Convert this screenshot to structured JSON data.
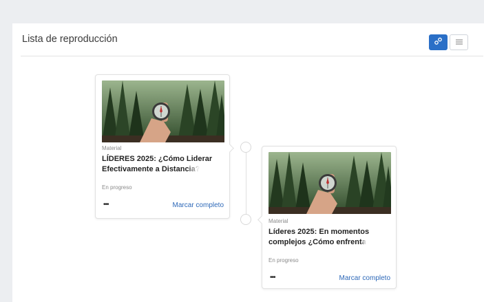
{
  "playlist": {
    "title": "Lista de reproducción",
    "view_modes": [
      {
        "icon": "diagram-icon",
        "active": true
      },
      {
        "icon": "list-icon",
        "active": false
      }
    ]
  },
  "items": [
    {
      "type": "Material",
      "title_line1": "LÍDERES 2025: ¿Cómo Liderar",
      "title_line2_a": "Efectivamente a Distan",
      "title_line2_b": "cia?",
      "status": "En progreso",
      "more": "•••",
      "action": "Marcar completo"
    },
    {
      "type": "Material",
      "title_line1": "Líderes 2025: En momentos",
      "title_line2_a": "complejos ¿Cómo enfren",
      "title_line2_b": "ta",
      "status": "En progreso",
      "more": "•••",
      "action": "Marcar completo"
    }
  ],
  "colors": {
    "accent": "#2a6fc7",
    "link": "#2d68b8",
    "background": "#eceef1"
  }
}
